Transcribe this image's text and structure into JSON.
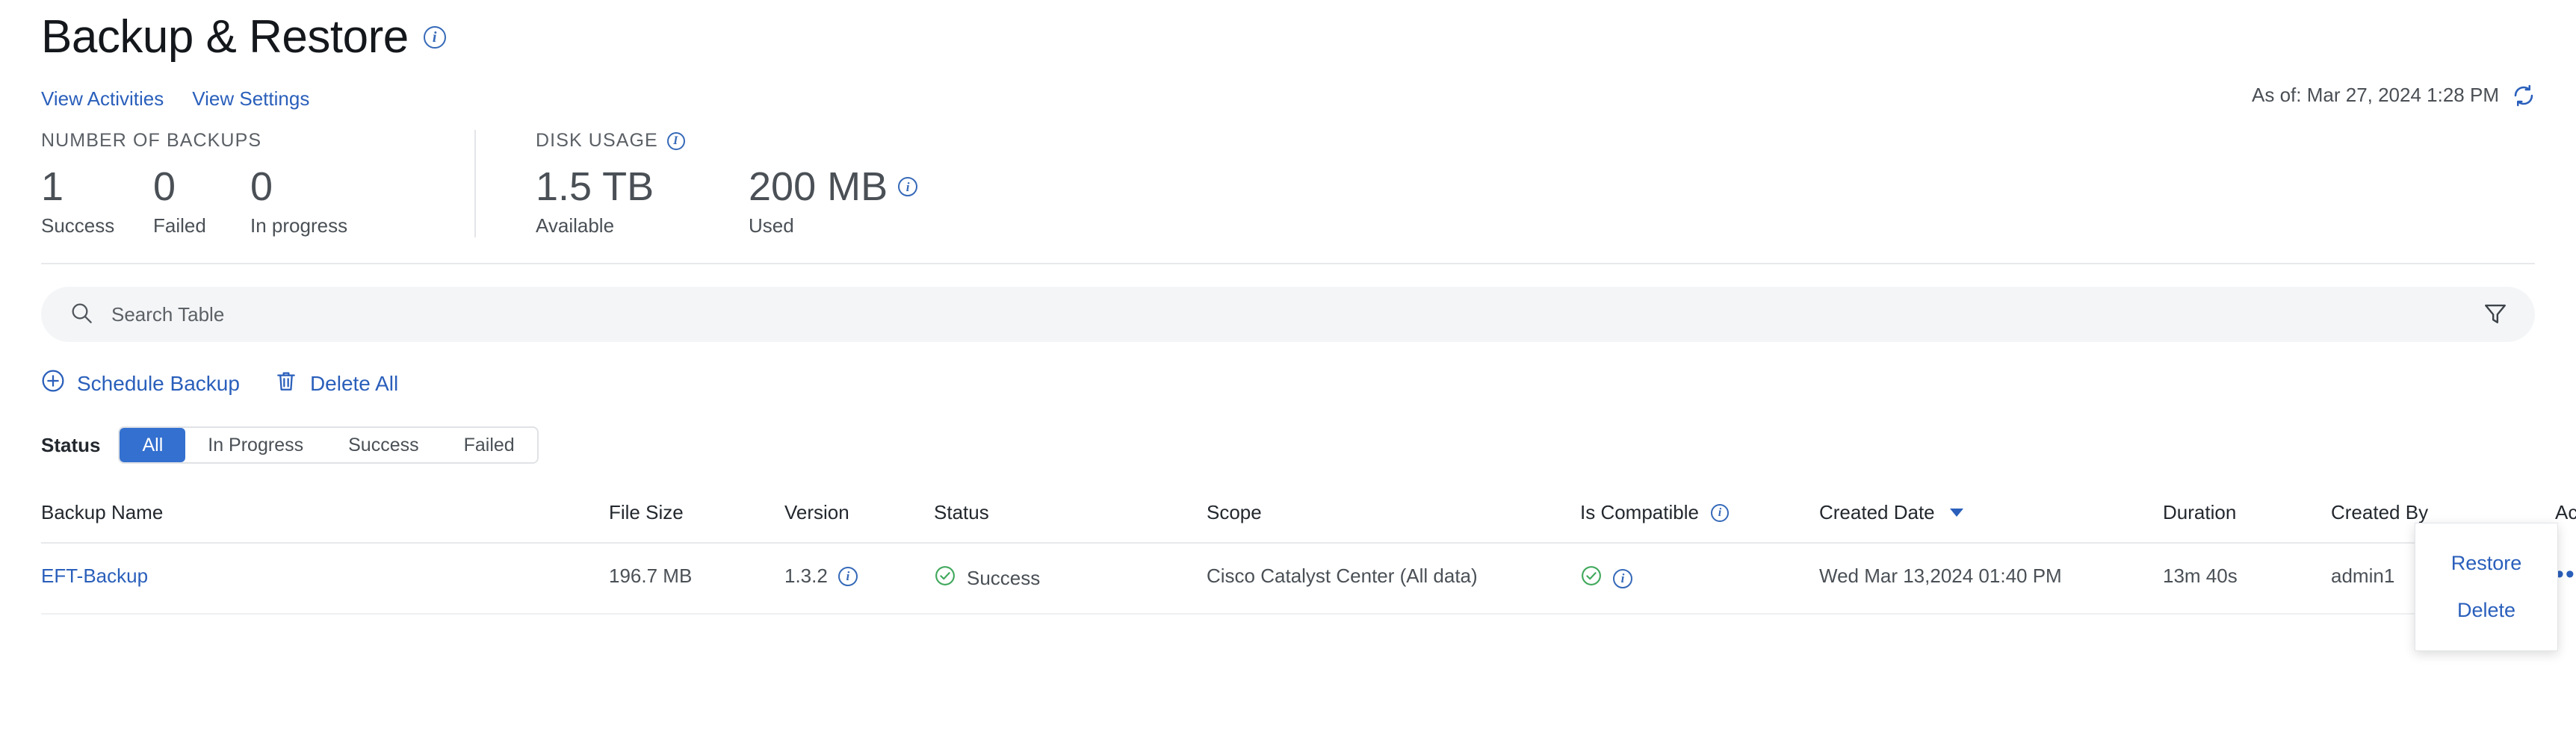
{
  "header": {
    "title": "Backup & Restore",
    "title_info_icon": "info-icon",
    "links": [
      {
        "label": "View Activities",
        "name": "view-activities-link"
      },
      {
        "label": "View Settings",
        "name": "view-settings-link"
      }
    ],
    "as_of": "As of: Mar 27, 2024 1:28 PM",
    "refresh_icon": "refresh-icon"
  },
  "stats": {
    "backups": {
      "heading": "NUMBER OF BACKUPS",
      "items": [
        {
          "value": "1",
          "label": "Success"
        },
        {
          "value": "0",
          "label": "Failed"
        },
        {
          "value": "0",
          "label": "In progress"
        }
      ]
    },
    "disk": {
      "heading": "DISK USAGE",
      "heading_info_icon": "info-icon",
      "items": [
        {
          "value": "1.5 TB",
          "label": "Available",
          "info": false
        },
        {
          "value": "200 MB",
          "label": "Used",
          "info": true
        }
      ]
    }
  },
  "search": {
    "placeholder": "Search Table",
    "value": "",
    "search_icon": "search-icon",
    "filter_icon": "filter-icon"
  },
  "toolbar": {
    "schedule_backup_label": "Schedule Backup",
    "schedule_backup_icon": "plus-circle-icon",
    "delete_all_label": "Delete All",
    "delete_all_icon": "trash-icon"
  },
  "status_filter": {
    "label": "Status",
    "options": [
      "All",
      "In Progress",
      "Success",
      "Failed"
    ],
    "selected": "All"
  },
  "table": {
    "columns": [
      {
        "label": "Backup Name",
        "sorted": false,
        "info": false
      },
      {
        "label": "File Size",
        "sorted": false,
        "info": false
      },
      {
        "label": "Version",
        "sorted": false,
        "info": false
      },
      {
        "label": "Status",
        "sorted": false,
        "info": false
      },
      {
        "label": "Scope",
        "sorted": false,
        "info": false
      },
      {
        "label": "Is Compatible",
        "sorted": false,
        "info": true
      },
      {
        "label": "Created Date",
        "sorted": true,
        "info": false
      },
      {
        "label": "Duration",
        "sorted": false,
        "info": false
      },
      {
        "label": "Created By",
        "sorted": false,
        "info": false
      },
      {
        "label": "Actions",
        "sorted": false,
        "info": false
      }
    ],
    "rows": [
      {
        "backup_name": "EFT-Backup",
        "file_size": "196.7 MB",
        "version": "1.3.2",
        "version_info_icon": "info-icon",
        "status": "Success",
        "status_icon": "check-circle-icon",
        "scope": "Cisco Catalyst Center (All data)",
        "is_compatible_icon": "check-circle-icon",
        "is_compatible_info_icon": "info-icon",
        "created_date": "Wed Mar 13,2024 01:40 PM",
        "duration": "13m 40s",
        "created_by": "admin1",
        "actions_icon": "kebab-menu-icon"
      }
    ]
  },
  "dropdown": {
    "items": [
      {
        "label": "Restore",
        "name": "dropdown-item-restore"
      },
      {
        "label": "Delete",
        "name": "dropdown-item-delete"
      }
    ]
  },
  "colors": {
    "accent_blue": "#2a5fbb",
    "active_blue": "#3470cf",
    "success_green": "#40a85c",
    "text_dark": "#23282e",
    "text_muted": "#4a5056",
    "search_bg": "#f4f5f7",
    "border": "#e7e9eb"
  }
}
